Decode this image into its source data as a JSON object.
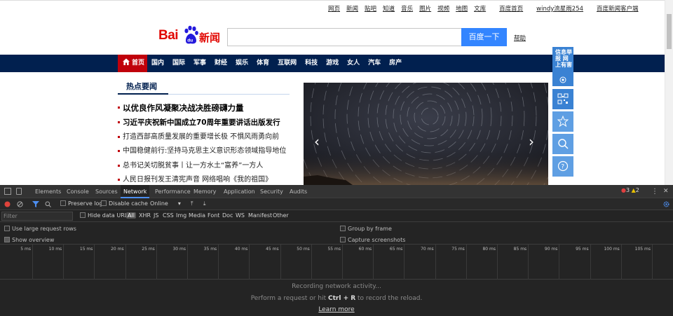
{
  "top_links": [
    "网页",
    "新闻",
    "贴吧",
    "知道",
    "音乐",
    "图片",
    "视频",
    "地图",
    "文库"
  ],
  "top_right": [
    "百度首页",
    "windy流星雨254",
    "百度新闻客户端"
  ],
  "logo": {
    "text": "Bai",
    "paw_text": "du",
    "news": "新闻"
  },
  "search": {
    "value": "",
    "button": "百度一下",
    "help": "帮助"
  },
  "nav": {
    "home": "首页",
    "items": [
      "国内",
      "国际",
      "军事",
      "财经",
      "娱乐",
      "体育",
      "互联网",
      "科技",
      "游戏",
      "女人",
      "汽车",
      "房产"
    ]
  },
  "hot": {
    "title": "热点要闻"
  },
  "headlines": [
    "以优良作风凝聚决战决胜磅礴力量",
    "习近平庆祝新中国成立70周年重要讲话出版发行",
    "打造西部高质量发展的重要增长极 不惧风雨勇向前",
    "中国稳健前行:坚持马克思主义意识形态领域指导地位",
    "总书记关切脱贫事丨让一方水土“富养”一方人",
    "人民日报刊发王清宪声音  网络唱响《我的祖国》"
  ],
  "side": {
    "report": "信息举报 网上有害"
  },
  "devtools": {
    "tabs": [
      "Elements",
      "Console",
      "Sources",
      "Network",
      "Performance",
      "Memory",
      "Application",
      "Security",
      "Audits"
    ],
    "active_tab": "Network",
    "errors": "3",
    "warnings": "2",
    "toolbar": {
      "preserve": "Preserve log",
      "cache": "Disable cache",
      "throttle": "Online"
    },
    "filter": {
      "placeholder": "Filter",
      "hide": "Hide data URLs",
      "types": [
        "All",
        "XHR",
        "JS",
        "CSS",
        "Img",
        "Media",
        "Font",
        "Doc",
        "WS",
        "Manifest",
        "Other"
      ]
    },
    "options": {
      "large": "Use large request rows",
      "overview": "Show overview",
      "group": "Group by frame",
      "screens": "Capture screenshots"
    },
    "ticks": [
      "5 ms",
      "10 ms",
      "15 ms",
      "20 ms",
      "25 ms",
      "30 ms",
      "35 ms",
      "40 ms",
      "45 ms",
      "50 ms",
      "55 ms",
      "60 ms",
      "65 ms",
      "70 ms",
      "75 ms",
      "80 ms",
      "85 ms",
      "90 ms",
      "95 ms",
      "100 ms",
      "105 ms",
      "1"
    ],
    "empty": {
      "line1": "Recording network activity...",
      "line2a": "Perform a request or hit ",
      "line2b": "Ctrl + R",
      "line2c": " to record the reload.",
      "line3": "Learn more"
    }
  },
  "colors": {
    "nav_bg": "#01204f",
    "accent_red": "#c0000b",
    "button_blue": "#3385ff",
    "devtools_bg": "#242424"
  }
}
